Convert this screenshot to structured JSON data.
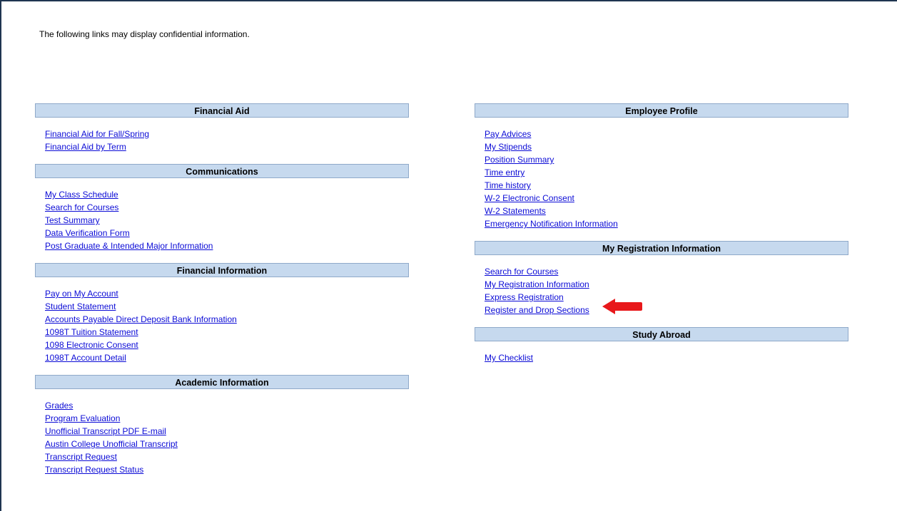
{
  "notice": "The following links may display confidential information.",
  "left_sections": [
    {
      "title": "Financial Aid",
      "links": [
        "Financial Aid for Fall/Spring",
        "Financial Aid by Term"
      ]
    },
    {
      "title": "Communications",
      "links": [
        "My Class Schedule",
        "Search for Courses",
        "Test Summary",
        "Data Verification Form",
        "Post Graduate & Intended Major Information"
      ]
    },
    {
      "title": "Financial Information",
      "links": [
        "Pay on My Account",
        "Student Statement",
        "Accounts Payable Direct Deposit Bank Information",
        "1098T Tuition Statement",
        "1098 Electronic Consent",
        "1098T Account Detail"
      ]
    },
    {
      "title": "Academic Information",
      "links": [
        "Grades",
        "Program Evaluation",
        "Unofficial Transcript PDF E-mail",
        "Austin College Unofficial Transcript",
        "Transcript Request",
        "Transcript Request Status"
      ]
    }
  ],
  "right_sections": [
    {
      "title": "Employee Profile",
      "links": [
        "Pay Advices",
        "My Stipends",
        "Position Summary",
        "Time entry",
        "Time history",
        "W-2 Electronic Consent",
        "W-2 Statements",
        "Emergency Notification Information"
      ]
    },
    {
      "title": "My Registration Information",
      "links": [
        "Search for Courses",
        "My Registration Information",
        "Express Registration",
        "Register and Drop Sections"
      ]
    },
    {
      "title": "Study Abroad",
      "links": [
        "My Checklist"
      ]
    }
  ],
  "colors": {
    "header_bg": "#c6d9ee",
    "link": "#0b0bd6",
    "arrow": "#e8181b"
  },
  "annotation": {
    "icon": "red-arrow-icon",
    "points_to": "Express Registration"
  }
}
